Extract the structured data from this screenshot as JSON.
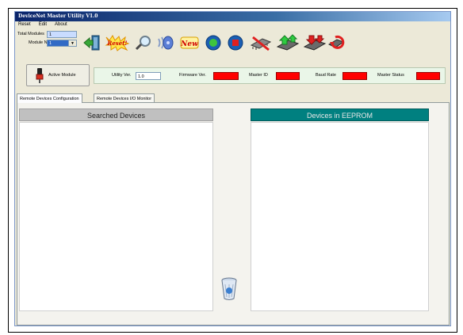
{
  "window": {
    "title": "DeviceNet Master Utility V1.0"
  },
  "menu": {
    "items": [
      "Reset",
      "Edit",
      "About"
    ]
  },
  "modules": {
    "total_label": "Total Modules",
    "total_value": "1",
    "module_no_label": "Module No",
    "module_no_value": "1"
  },
  "toolbar": {
    "buttons": [
      {
        "name": "exit-icon"
      },
      {
        "name": "reset-icon",
        "label": "Reset!"
      },
      {
        "name": "search-icon"
      },
      {
        "name": "scan-icon"
      },
      {
        "name": "new-icon",
        "label": "New"
      },
      {
        "name": "start-icon"
      },
      {
        "name": "stop-icon"
      },
      {
        "name": "chip-icon"
      },
      {
        "name": "upload-icon"
      },
      {
        "name": "download-icon"
      },
      {
        "name": "erase-icon"
      }
    ]
  },
  "active_module": {
    "label": "Active Module"
  },
  "info": {
    "utility_ver_label": "Utility Ver.",
    "utility_ver_value": "1.0",
    "firmware_ver_label": "Firmware Ver.",
    "master_id_label": "Master ID",
    "baud_rate_label": "Baud Rate",
    "master_status_label": "Master Status"
  },
  "tabs": [
    "Remote Devices Configuration",
    "Remote Devices I/O Monitor"
  ],
  "panels": {
    "searched_title": "Searched Devices",
    "eeprom_title": "Devices in EEPROM"
  },
  "colors": {
    "eeprom_header": "#008080",
    "searched_header": "#c0c0c0",
    "status_red": "#ff0000"
  }
}
